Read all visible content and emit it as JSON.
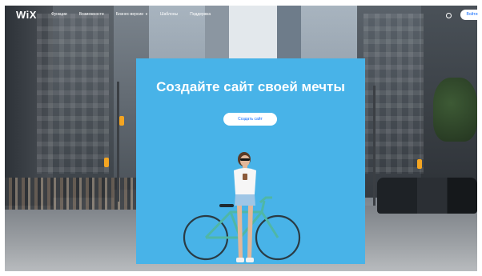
{
  "brand": {
    "logo": "WiX"
  },
  "nav": {
    "items": [
      {
        "label": "Функции"
      },
      {
        "label": "Возможности"
      },
      {
        "label": "Бизнес-версии"
      },
      {
        "label": "Шаблоны"
      },
      {
        "label": "Поддержка"
      }
    ],
    "login_label": "Войти",
    "language_icon": "globe-icon"
  },
  "hero": {
    "headline": "Создайте сайт своей мечты",
    "cta_label": "Создать сайт"
  },
  "colors": {
    "panel": "#48b3e8",
    "accent": "#116dff",
    "white": "#ffffff"
  }
}
